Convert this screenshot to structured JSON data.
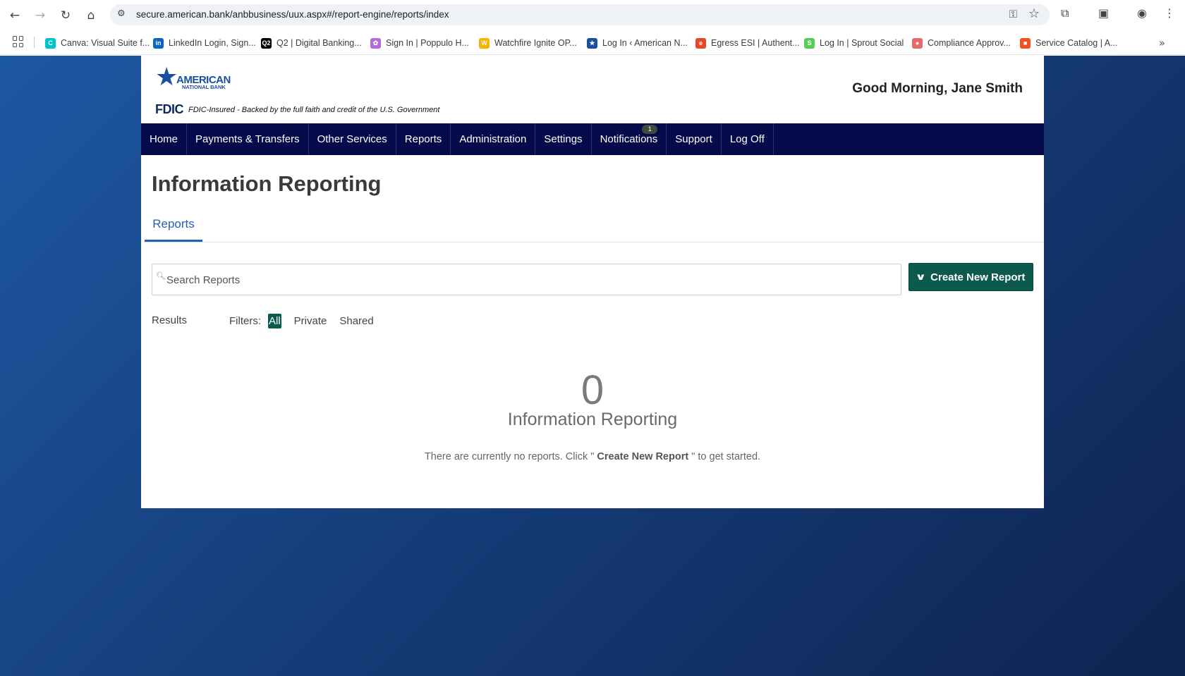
{
  "browser": {
    "url": "secure.american.bank/anbbusiness/uux.aspx#/report-engine/reports/index",
    "bookmarks": [
      {
        "label": "Canva: Visual Suite f...",
        "icon": "canva-icon",
        "color": "#00c4cc"
      },
      {
        "label": "LinkedIn Login, Sign...",
        "icon": "linkedin-icon",
        "color": "#0a66c2"
      },
      {
        "label": "Q2 | Digital Banking...",
        "icon": "q2-icon",
        "color": "#000000"
      },
      {
        "label": "Sign In | Poppulo H...",
        "icon": "poppulo-icon",
        "color": "#b26bd8"
      },
      {
        "label": "Watchfire Ignite OP...",
        "icon": "watchfire-icon",
        "color": "#f5b300"
      },
      {
        "label": "Log In ‹ American N...",
        "icon": "anb-star-icon",
        "color": "#1a4fa0"
      },
      {
        "label": "Egress ESI | Authent...",
        "icon": "egress-icon",
        "color": "#e8462b"
      },
      {
        "label": "Log In | Sprout Social",
        "icon": "sprout-icon",
        "color": "#59cb59"
      },
      {
        "label": "Compliance Approv...",
        "icon": "compliance-icon",
        "color": "#e86a6a"
      },
      {
        "label": "Service Catalog | A...",
        "icon": "microsoft-icon",
        "color": "#f25022"
      }
    ]
  },
  "header": {
    "logo_line1": "AMERICAN",
    "logo_line2": "NATIONAL BANK",
    "fdic_mark": "FDIC",
    "fdic_tagline": "FDIC-Insured - Backed by the full faith and credit of the U.S. Government",
    "greeting": "Good Morning, Jane Smith"
  },
  "nav": {
    "items": [
      "Home",
      "Payments & Transfers",
      "Other Services",
      "Reports",
      "Administration",
      "Settings",
      "Notifications",
      "Support",
      "Log Off"
    ],
    "notifications_badge": "1"
  },
  "main": {
    "title": "Information Reporting",
    "tab": "Reports",
    "search_placeholder": "Search Reports",
    "create_button": "Create New Report",
    "results_label": "Results",
    "filters_label": "Filters:",
    "filters": [
      "All",
      "Private",
      "Shared"
    ],
    "active_filter": "All",
    "empty": {
      "count": "0",
      "title": "Information Reporting",
      "msg_before": "There are currently no reports. Click \"",
      "msg_bold": " Create New Report ",
      "msg_after": "\" to get started."
    }
  }
}
